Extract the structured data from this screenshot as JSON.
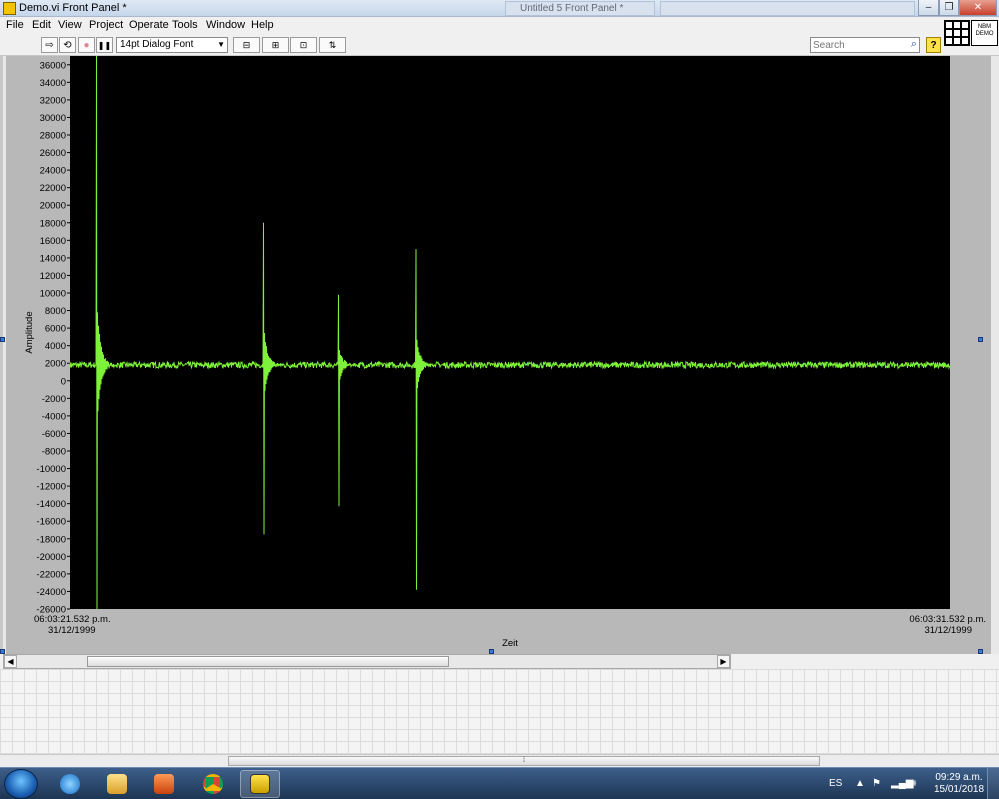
{
  "window": {
    "title": "Demo.vi Front Panel *",
    "background_tab": "Untitled 5 Front Panel *",
    "controls": {
      "minimize": "–",
      "maximize": "❐",
      "close": "✕"
    }
  },
  "menu": {
    "items": [
      "File",
      "Edit",
      "View",
      "Project",
      "Operate",
      "Tools",
      "Window",
      "Help"
    ]
  },
  "toolbar": {
    "run_icon": "⇨",
    "run_continuous_icon": "⟲",
    "abort_icon": "●",
    "pause_icon": "❚❚",
    "font_selector": "14pt Dialog Font",
    "align_icon": "⊟",
    "distribute_icon": "⊞",
    "resize_icon": "⊡",
    "reorder_icon": "⇅",
    "search_placeholder": "Search",
    "help": "?",
    "demo_badge": "NBM DEMO"
  },
  "chart_data": {
    "type": "line",
    "ylabel": "Amplitude",
    "xlabel": "Zeit",
    "x_start": "06:03:21.532 p.m.",
    "x_start_date": "31/12/1999",
    "x_end": "06:03:31.532 p.m.",
    "x_end_date": "31/12/1999",
    "ylim": [
      -26000,
      37000
    ],
    "yticks": [
      36000,
      34000,
      32000,
      30000,
      28000,
      26000,
      24000,
      22000,
      20000,
      18000,
      16000,
      14000,
      12000,
      10000,
      8000,
      6000,
      4000,
      2000,
      0,
      -2000,
      -4000,
      -6000,
      -8000,
      -10000,
      -12000,
      -14000,
      -16000,
      -18000,
      -20000,
      -22000,
      -24000,
      -26000
    ],
    "background_color": "#000000",
    "line_color": "#7ef23a",
    "baseline": 1800,
    "noise_amplitude": 350,
    "spikes": [
      {
        "position": 0.03,
        "max": 37000,
        "min": -26000
      },
      {
        "position": 0.22,
        "max": 18000,
        "min": -17500
      },
      {
        "position": 0.305,
        "max": 9800,
        "min": -14300
      },
      {
        "position": 0.393,
        "max": 15000,
        "min": -23800
      }
    ]
  },
  "taskbar": {
    "language": "ES",
    "time": "09:29 a.m.",
    "date": "15/01/2018",
    "apps": [
      "internet-explorer",
      "file-explorer",
      "media-player",
      "chrome",
      "labview"
    ]
  }
}
